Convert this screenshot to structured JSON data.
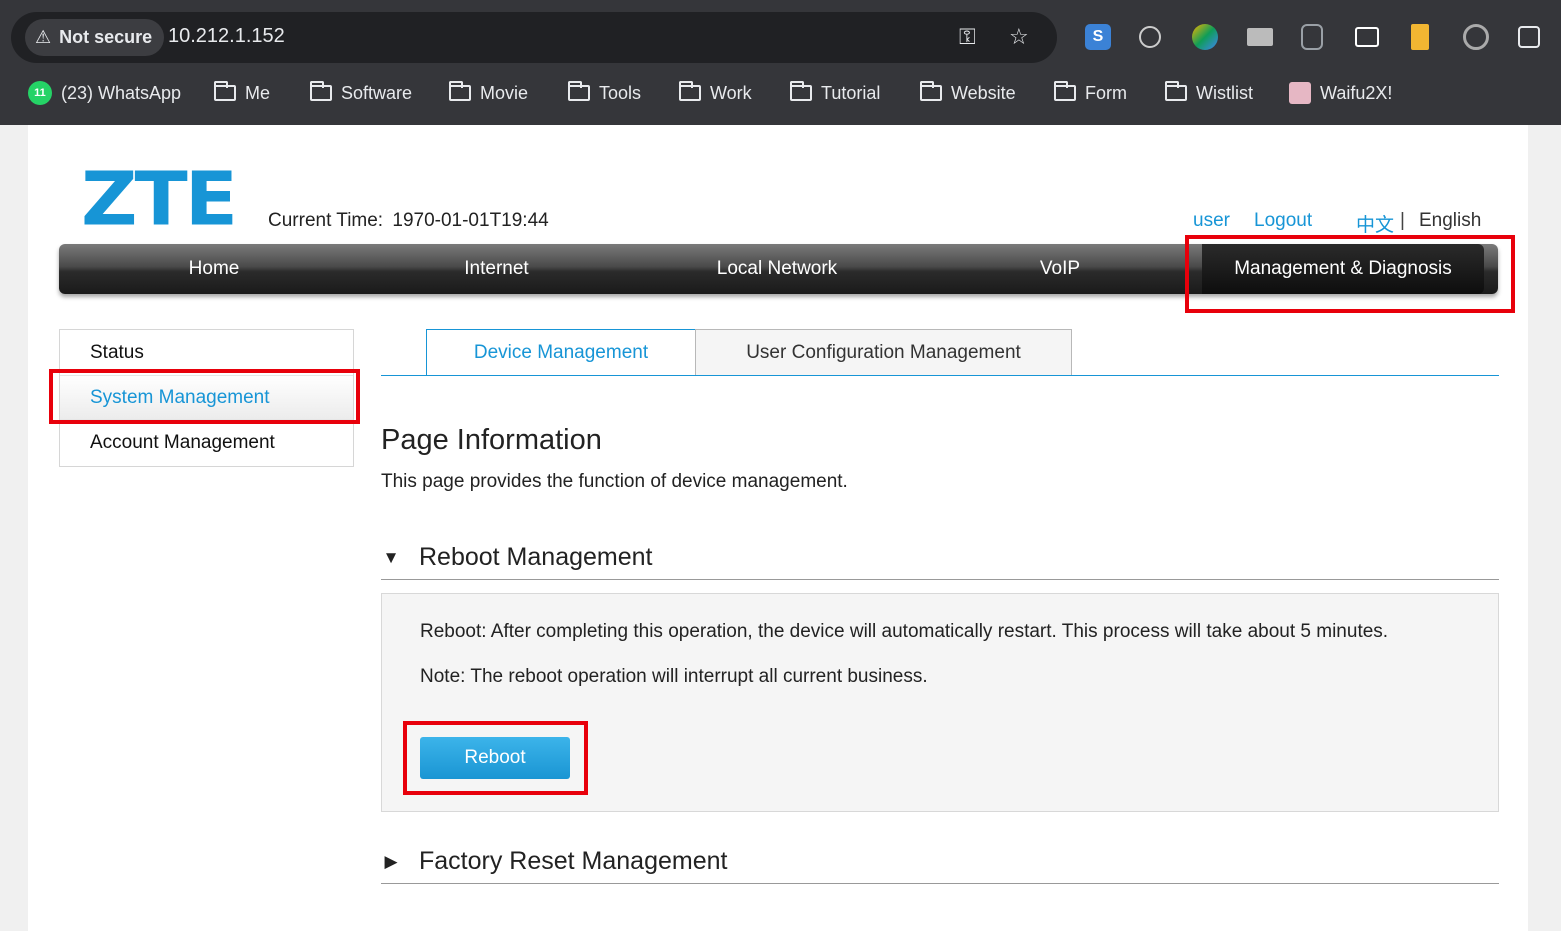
{
  "browser": {
    "security_label": "Not secure",
    "url": "10.212.1.152",
    "bookmarks": [
      {
        "label": "(23) WhatsApp",
        "badge": "11"
      },
      {
        "label": "Me"
      },
      {
        "label": "Software"
      },
      {
        "label": "Movie"
      },
      {
        "label": "Tools"
      },
      {
        "label": "Work"
      },
      {
        "label": "Tutorial"
      },
      {
        "label": "Website"
      },
      {
        "label": "Form"
      },
      {
        "label": "Wistlist"
      },
      {
        "label": "Waifu2X!"
      }
    ],
    "extensions": [
      "s-icon",
      "link-icon",
      "color-icon",
      "window-icon",
      "lock-icon",
      "screen-icon",
      "clipboard-icon",
      "spiral-icon",
      "puzzle-icon"
    ]
  },
  "router": {
    "logo": "ZTE",
    "current_time_label": "Current Time:",
    "current_time_value": "1970-01-01T19:44",
    "user_label": "user",
    "logout_label": "Logout",
    "lang_zh": "中文",
    "lang_sep": "|",
    "lang_en": "English",
    "nav": [
      "Home",
      "Internet",
      "Local Network",
      "VoIP",
      "Management & Diagnosis"
    ],
    "sidebar": [
      "Status",
      "System Management",
      "Account Management"
    ],
    "tabs": [
      "Device Management",
      "User Configuration Management"
    ],
    "page_title": "Page Information",
    "page_desc": "This page provides the function of device management.",
    "reboot_section": {
      "title": "Reboot Management",
      "text1": "Reboot: After completing this operation, the device will automatically restart. This process will take about 5 minutes.",
      "text2": "Note: The reboot operation will interrupt all current business.",
      "button": "Reboot"
    },
    "factory_section": {
      "title": "Factory Reset Management"
    }
  },
  "colors": {
    "accent": "#1795d6",
    "highlight": "#e8000b"
  }
}
